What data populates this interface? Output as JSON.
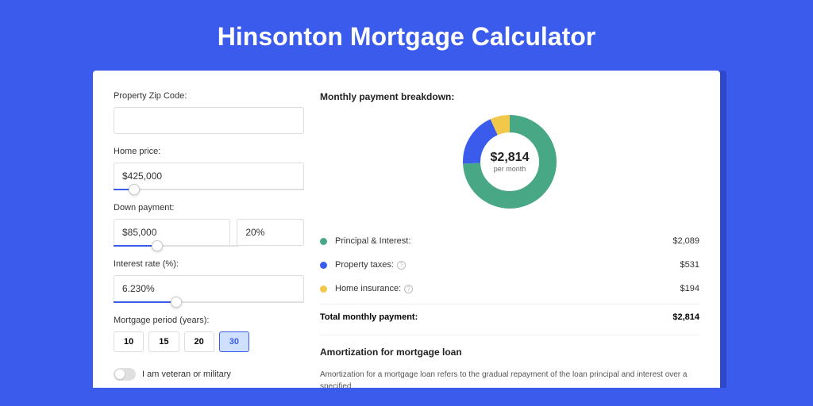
{
  "title": "Hinsonton Mortgage Calculator",
  "form": {
    "zip": {
      "label": "Property Zip Code:",
      "value": ""
    },
    "home_price": {
      "label": "Home price:",
      "value": "$425,000",
      "slider_pct": 8
    },
    "down_payment": {
      "label": "Down payment:",
      "value": "$85,000",
      "pct": "20%",
      "slider_pct": 20
    },
    "interest": {
      "label": "Interest rate (%):",
      "value": "6.230%",
      "slider_pct": 30
    },
    "period": {
      "label": "Mortgage period (years):",
      "options": [
        "10",
        "15",
        "20",
        "30"
      ],
      "selected": "30"
    },
    "veteran": {
      "label": "I am veteran or military",
      "on": false
    }
  },
  "breakdown": {
    "title": "Monthly payment breakdown:",
    "center_amount": "$2,814",
    "center_sub": "per month",
    "items": [
      {
        "label": "Principal & Interest:",
        "value": "$2,089",
        "color": "#48a885",
        "info": false
      },
      {
        "label": "Property taxes:",
        "value": "$531",
        "color": "#3b5bed",
        "info": true
      },
      {
        "label": "Home insurance:",
        "value": "$194",
        "color": "#f2c84b",
        "info": true
      }
    ],
    "total_label": "Total monthly payment:",
    "total_value": "$2,814"
  },
  "chart_data": {
    "type": "pie",
    "title": "Monthly payment breakdown",
    "series": [
      {
        "name": "Principal & Interest",
        "value": 2089,
        "color": "#48a885"
      },
      {
        "name": "Property taxes",
        "value": 531,
        "color": "#3b5bed"
      },
      {
        "name": "Home insurance",
        "value": 194,
        "color": "#f2c84b"
      }
    ],
    "total": 2814
  },
  "amort": {
    "title": "Amortization for mortgage loan",
    "text": "Amortization for a mortgage loan refers to the gradual repayment of the loan principal and interest over a specified"
  }
}
